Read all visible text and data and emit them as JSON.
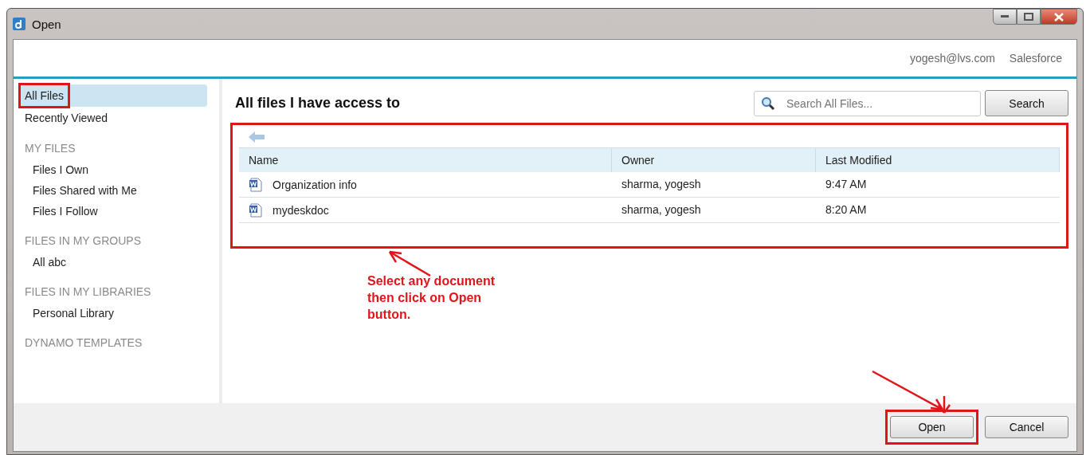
{
  "window": {
    "title": "Open"
  },
  "account": {
    "user": "yogesh@lvs.com",
    "org": "Salesforce"
  },
  "sidebar": {
    "items": [
      {
        "label": "All Files",
        "selected": true,
        "highlighted": true
      },
      {
        "label": "Recently Viewed",
        "selected": false,
        "highlighted": false
      }
    ],
    "sections": [
      {
        "heading": "MY FILES",
        "items": [
          {
            "label": "Files I Own",
            "selected": false
          },
          {
            "label": "Files Shared with Me",
            "selected": false
          },
          {
            "label": "Files I Follow",
            "selected": false
          }
        ]
      },
      {
        "heading": "FILES IN MY GROUPS",
        "items": [
          {
            "label": "All abc",
            "selected": false
          }
        ]
      },
      {
        "heading": "FILES IN MY LIBRARIES",
        "items": [
          {
            "label": "Personal Library",
            "selected": false
          }
        ]
      },
      {
        "heading": "DYNAMO TEMPLATES"
      }
    ]
  },
  "content": {
    "title": "All files I have access to",
    "search": {
      "placeholder": "Search All Files...",
      "button": "Search"
    }
  },
  "file_list": {
    "highlighted": true,
    "columns": [
      "Name",
      "Owner",
      "Last Modified"
    ],
    "rows": [
      {
        "name": "Organization info",
        "owner": "sharma, yogesh",
        "modified": "9:47 AM"
      },
      {
        "name": "mydeskdoc",
        "owner": "sharma, yogesh",
        "modified": "8:20 AM"
      }
    ]
  },
  "annotation": {
    "text": "Select any document then click on Open button."
  },
  "buttons": [
    {
      "label": "Open",
      "highlighted": true
    },
    {
      "label": "Cancel",
      "highlighted": false
    }
  ]
}
